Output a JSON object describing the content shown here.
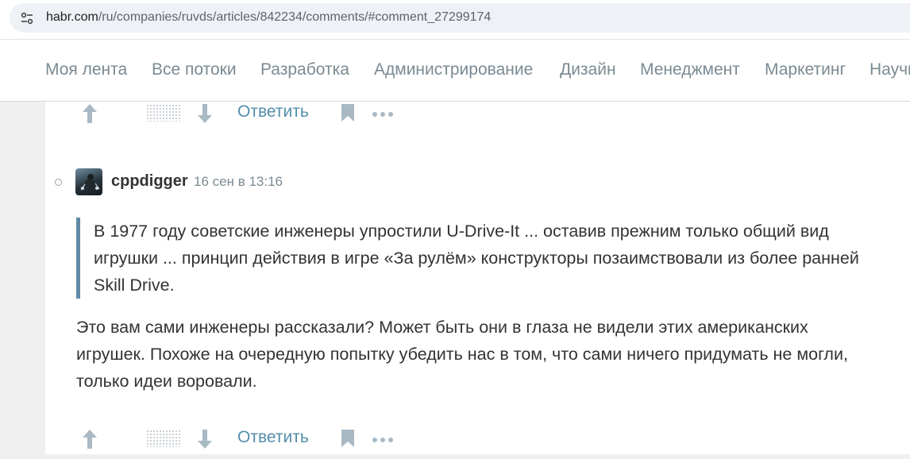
{
  "browser": {
    "url_host": "habr.com",
    "url_path": "/ru/companies/ruvds/articles/842234/comments/#comment_27299174",
    "site_info_icon": "tune-icon"
  },
  "nav": {
    "items": [
      {
        "label": "Моя лента"
      },
      {
        "label": "Все потоки"
      },
      {
        "label": "Разработка"
      },
      {
        "label": "Администрирование"
      },
      {
        "label": "Дизайн"
      },
      {
        "label": "Менеджмент"
      },
      {
        "label": "Маркетинг"
      },
      {
        "label": "Научпоп"
      }
    ]
  },
  "previous_comment_actions": {
    "reply_label": "Ответить"
  },
  "comment": {
    "author": "cppdigger",
    "datetime": "16 сен в 13:16",
    "quote": "В 1977 году советские инженеры упростили U-Drive-It ... оставив прежним только общий вид игрушки ... принцип действия в игре «За рулём» конструкторы позаимствовали из более ранней Skill Drive.",
    "text": "Это вам сами инженеры рассказали? Может быть они в глаза не видели этих американских игрушек. Похоже на очередную попытку убедить нас в том, что сами ничего придумать не могли, только идеи воровали.",
    "reply_label": "Ответить"
  },
  "colors": {
    "accent": "#548eaa",
    "muted": "#7b8a93",
    "quote_border": "#5e8aa4",
    "icon": "#a9b9c4"
  }
}
